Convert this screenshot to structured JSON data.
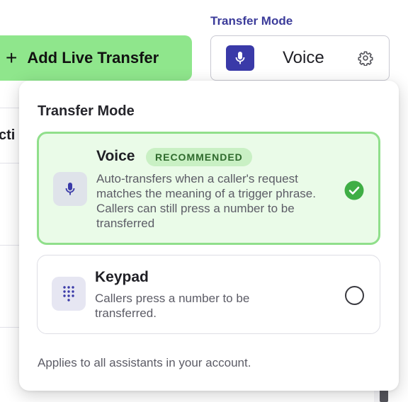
{
  "background": {
    "add_button": {
      "icon": "plus-icon",
      "label": "Add Live Transfer"
    },
    "column_header_fragment": "cti",
    "mode_field": {
      "label": "Transfer Mode",
      "value": "Voice",
      "icon": "mic-icon",
      "settings_icon": "gear-icon"
    }
  },
  "popover": {
    "title": "Transfer Mode",
    "options": [
      {
        "name": "Voice",
        "icon": "mic-icon",
        "badge": "RECOMMENDED",
        "description": "Auto-transfers when a caller's request matches the meaning of a trigger phrase. Callers can still press a number to be transferred",
        "selected": true
      },
      {
        "name": "Keypad",
        "icon": "keypad-icon",
        "description": "Callers press a number to be transferred.",
        "selected": false
      }
    ],
    "footer": "Applies to all assistants in your account."
  },
  "colors": {
    "accent_green": "#8fe68c",
    "selected_bg": "#eafbe8",
    "check_green": "#3fae45",
    "brand_indigo": "#3a3aa8"
  }
}
